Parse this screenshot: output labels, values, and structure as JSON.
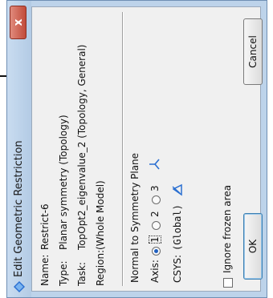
{
  "window": {
    "title": "Edit Geometric Restriction",
    "close_label": "x"
  },
  "info": [
    {
      "key": "Name:",
      "value": "Restrict-6"
    },
    {
      "key": "Type:",
      "value": "Planar symmetry (Topology)"
    },
    {
      "key": "Task:",
      "value": "TopOpt2_eigenvalue_2 (Topology, General)"
    },
    {
      "key": "Region:",
      "value": "(Whole Model)"
    }
  ],
  "symmetry": {
    "title": "Normal to Symmetry Plane",
    "axis_label": "Axis:",
    "axis_options": [
      "1",
      "2",
      "3"
    ],
    "axis_selected": "1",
    "csys_label": "CSYS:",
    "csys_value": "(Global)"
  },
  "ignore_frozen": {
    "label": "Ignore frozen area",
    "checked": false
  },
  "buttons": {
    "ok": "OK",
    "cancel": "Cancel"
  },
  "colors": {
    "titlebar": "#bdd3ea",
    "close": "#c14b3a",
    "client": "#f0f0f0",
    "icon_blue": "#2a6fd1"
  },
  "icons": {
    "app": "diamond-arrows-icon",
    "csys_pick": "pick-csys-icon",
    "csys_create": "create-csys-icon"
  }
}
